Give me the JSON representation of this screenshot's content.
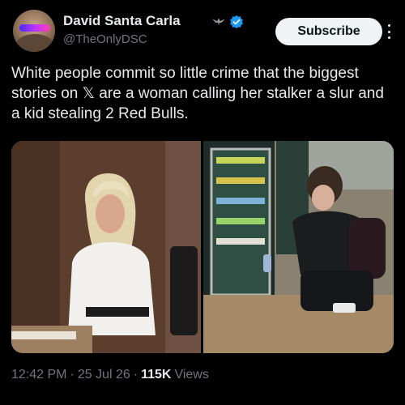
{
  "author": {
    "name": "David Santa Carla",
    "handle": "@TheOnlyDSC",
    "badges": [
      "eagle-icon",
      "verified-icon"
    ]
  },
  "header": {
    "subscribe_label": "Subscribe",
    "more_icon": "more-vertical-icon"
  },
  "tweet": {
    "text": "White people commit so little crime that the biggest stories on 𝕏 are a woman calling her stalker a slur and a kid stealing 2 Red Bulls."
  },
  "media": {
    "count": 2
  },
  "meta": {
    "time": "12:42 PM",
    "date": "25 Jul 26",
    "views_count": "115K",
    "views_label": "Views",
    "separator": "·"
  },
  "colors": {
    "background": "#000000",
    "text": "#e7e9ea",
    "muted": "#71767b",
    "verified": "#1d9bf0",
    "button_bg": "#eff3f4"
  }
}
